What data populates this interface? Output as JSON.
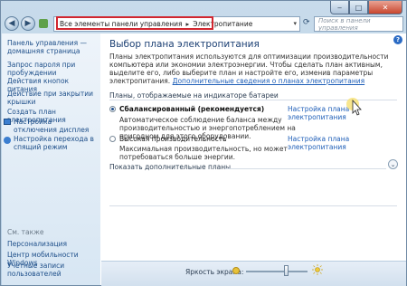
{
  "window": {
    "controls": {
      "minimize": "‒",
      "maximize": "□",
      "close": "✕"
    }
  },
  "nav": {
    "back_icon": "back-arrow-icon",
    "forward_icon": "forward-arrow-icon",
    "breadcrumb_root": "Все элементы панели управления",
    "breadcrumb_sep": "▸",
    "breadcrumb_current": "Электропитание",
    "search_placeholder": "Поиск в панели управления"
  },
  "sidebar": {
    "home": "Панель управления — домашняя страница",
    "items": [
      {
        "label": "Запрос пароля при пробуждении",
        "icon": null
      },
      {
        "label": "Действия кнопок питания",
        "icon": null
      },
      {
        "label": "Действие при закрытии крышки",
        "icon": null
      },
      {
        "label": "Создать план электропитания",
        "icon": null
      },
      {
        "label": "Настройка отключения дисплея",
        "icon": "display-icon"
      },
      {
        "label": "Настройка перехода в спящий режим",
        "icon": "sleep-icon"
      }
    ],
    "see_also": "См. также",
    "see_also_items": [
      "Персонализация",
      "Центр мобильности Windows",
      "Учетные записи пользователей"
    ]
  },
  "main": {
    "title": "Выбор плана электропитания",
    "description": "Планы электропитания используются для оптимизации производительности компьютера или экономии электроэнергии. Чтобы сделать план активным, выделите его, либо выберите план и настройте его, изменив параметры электропитания.",
    "description_link": "Дополнительные сведения о планах электропитания",
    "group_label": "Планы, отображаемые на индикаторе батареи",
    "plans": [
      {
        "name": "Сбалансированный (рекомендуется)",
        "selected": true,
        "settings_link": "Настройка плана электропитания",
        "desc": "Автоматическое соблюдение баланса между производительностью и энергопотреблением на пригодном для этого оборудовании."
      },
      {
        "name": "Высокая производительность",
        "selected": false,
        "settings_link": "Настройка плана электропитания",
        "desc": "Максимальная производительность, но может потребоваться больше энергии."
      }
    ],
    "show_more": "Показать дополнительные планы",
    "help": "?"
  },
  "footer": {
    "brightness_label": "Яркость экрана:",
    "brightness_level": 0.65
  },
  "colors": {
    "accent_link": "#1f5fb8",
    "highlight_box": "#d1262f",
    "title": "#1b3f73"
  }
}
